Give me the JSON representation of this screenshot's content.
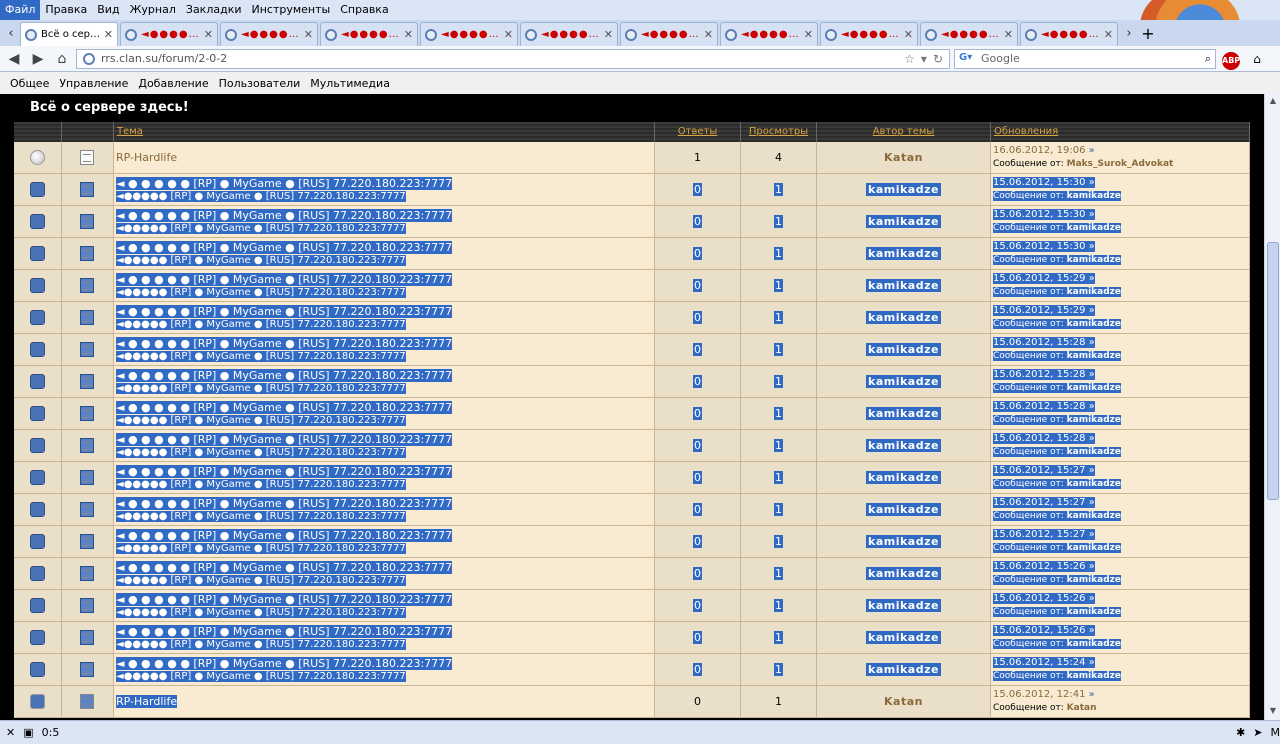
{
  "menubar": [
    "Файл",
    "Правка",
    "Вид",
    "Журнал",
    "Закладки",
    "Инструменты",
    "Справка"
  ],
  "tabs": {
    "active_title": "Всё о сер…",
    "other_title": "◄●●●●…"
  },
  "navbar": {
    "url": "rrs.clan.su/forum/2-0-2",
    "search_placeholder": "Google"
  },
  "bookmarks": [
    "Общее",
    "Управление",
    "Добавление",
    "Пользователи",
    "Мультимедиа"
  ],
  "forum": {
    "title": "Всё о сервере здесь!",
    "headers": {
      "topic": "Тема",
      "replies": "Ответы",
      "views": "Просмотры",
      "author": "Автор темы",
      "updates": "Обновления"
    },
    "msg_from": "Сообщение от:",
    "rows": [
      {
        "title": "RP-Hardlife",
        "subtitle": "",
        "replies": "1",
        "views": "4",
        "author": "Katan",
        "date": "16.06.2012, 19:06",
        "last": "Maks_Surok_Advokat",
        "hl": false,
        "icon": "new"
      },
      {
        "title": "◄ ● ● ● ● ● [RP] ● MyGame ● [RUS] 77.220.180.223:7777",
        "subtitle": "◄●●●●● [RP] ● MyGame ● [RUS] 77.220.180.223:7777",
        "replies": "0",
        "views": "1",
        "author": "kamikadze",
        "date": "15.06.2012, 15:30",
        "last": "kamikadze",
        "hl": true,
        "icon": "new"
      },
      {
        "title": "◄ ● ● ● ● ● [RP] ● MyGame ● [RUS] 77.220.180.223:7777",
        "subtitle": "◄●●●●● [RP] ● MyGame ● [RUS] 77.220.180.223:7777",
        "replies": "0",
        "views": "1",
        "author": "kamikadze",
        "date": "15.06.2012, 15:30",
        "last": "kamikadze",
        "hl": true,
        "icon": "old"
      },
      {
        "title": "◄ ● ● ● ● ● [RP] ● MyGame ● [RUS] 77.220.180.223:7777",
        "subtitle": "◄●●●●● [RP] ● MyGame ● [RUS] 77.220.180.223:7777",
        "replies": "0",
        "views": "1",
        "author": "kamikadze",
        "date": "15.06.2012, 15:30",
        "last": "kamikadze",
        "hl": true,
        "icon": "old"
      },
      {
        "title": "◄ ● ● ● ● ● [RP] ● MyGame ● [RUS] 77.220.180.223:7777",
        "subtitle": "◄●●●●● [RP] ● MyGame ● [RUS] 77.220.180.223:7777",
        "replies": "0",
        "views": "1",
        "author": "kamikadze",
        "date": "15.06.2012, 15:29",
        "last": "kamikadze",
        "hl": true,
        "icon": "old"
      },
      {
        "title": "◄ ● ● ● ● ● [RP] ● MyGame ● [RUS] 77.220.180.223:7777",
        "subtitle": "◄●●●●● [RP] ● MyGame ● [RUS] 77.220.180.223:7777",
        "replies": "0",
        "views": "1",
        "author": "kamikadze",
        "date": "15.06.2012, 15:29",
        "last": "kamikadze",
        "hl": true,
        "icon": "old"
      },
      {
        "title": "◄ ● ● ● ● ● [RP] ● MyGame ● [RUS] 77.220.180.223:7777",
        "subtitle": "◄●●●●● [RP] ● MyGame ● [RUS] 77.220.180.223:7777",
        "replies": "0",
        "views": "1",
        "author": "kamikadze",
        "date": "15.06.2012, 15:28",
        "last": "kamikadze",
        "hl": true,
        "icon": "old"
      },
      {
        "title": "◄ ● ● ● ● ● [RP] ● MyGame ● [RUS] 77.220.180.223:7777",
        "subtitle": "◄●●●●● [RP] ● MyGame ● [RUS] 77.220.180.223:7777",
        "replies": "0",
        "views": "1",
        "author": "kamikadze",
        "date": "15.06.2012, 15:28",
        "last": "kamikadze",
        "hl": true,
        "icon": "old"
      },
      {
        "title": "◄ ● ● ● ● ● [RP] ● MyGame ● [RUS] 77.220.180.223:7777",
        "subtitle": "◄●●●●● [RP] ● MyGame ● [RUS] 77.220.180.223:7777",
        "replies": "0",
        "views": "1",
        "author": "kamikadze",
        "date": "15.06.2012, 15:28",
        "last": "kamikadze",
        "hl": true,
        "icon": "old"
      },
      {
        "title": "◄ ● ● ● ● ● [RP] ● MyGame ● [RUS] 77.220.180.223:7777",
        "subtitle": "◄●●●●● [RP] ● MyGame ● [RUS] 77.220.180.223:7777",
        "replies": "0",
        "views": "1",
        "author": "kamikadze",
        "date": "15.06.2012, 15:28",
        "last": "kamikadze",
        "hl": true,
        "icon": "old"
      },
      {
        "title": "◄ ● ● ● ● ● [RP] ● MyGame ● [RUS] 77.220.180.223:7777",
        "subtitle": "◄●●●●● [RP] ● MyGame ● [RUS] 77.220.180.223:7777",
        "replies": "0",
        "views": "1",
        "author": "kamikadze",
        "date": "15.06.2012, 15:27",
        "last": "kamikadze",
        "hl": true,
        "icon": "old"
      },
      {
        "title": "◄ ● ● ● ● ● [RP] ● MyGame ● [RUS] 77.220.180.223:7777",
        "subtitle": "◄●●●●● [RP] ● MyGame ● [RUS] 77.220.180.223:7777",
        "replies": "0",
        "views": "1",
        "author": "kamikadze",
        "date": "15.06.2012, 15:27",
        "last": "kamikadze",
        "hl": true,
        "icon": "old"
      },
      {
        "title": "◄ ● ● ● ● ● [RP] ● MyGame ● [RUS] 77.220.180.223:7777",
        "subtitle": "◄●●●●● [RP] ● MyGame ● [RUS] 77.220.180.223:7777",
        "replies": "0",
        "views": "1",
        "author": "kamikadze",
        "date": "15.06.2012, 15:27",
        "last": "kamikadze",
        "hl": true,
        "icon": "old"
      },
      {
        "title": "◄ ● ● ● ● ● [RP] ● MyGame ● [RUS] 77.220.180.223:7777",
        "subtitle": "◄●●●●● [RP] ● MyGame ● [RUS] 77.220.180.223:7777",
        "replies": "0",
        "views": "1",
        "author": "kamikadze",
        "date": "15.06.2012, 15:26",
        "last": "kamikadze",
        "hl": true,
        "icon": "old"
      },
      {
        "title": "◄ ● ● ● ● ● [RP] ● MyGame ● [RUS] 77.220.180.223:7777",
        "subtitle": "◄●●●●● [RP] ● MyGame ● [RUS] 77.220.180.223:7777",
        "replies": "0",
        "views": "1",
        "author": "kamikadze",
        "date": "15.06.2012, 15:26",
        "last": "kamikadze",
        "hl": true,
        "icon": "old"
      },
      {
        "title": "◄ ● ● ● ● ● [RP] ● MyGame ● [RUS] 77.220.180.223:7777",
        "subtitle": "◄●●●●● [RP] ● MyGame ● [RUS] 77.220.180.223:7777",
        "replies": "0",
        "views": "1",
        "author": "kamikadze",
        "date": "15.06.2012, 15:26",
        "last": "kamikadze",
        "hl": true,
        "icon": "old"
      },
      {
        "title": "◄ ● ● ● ● ● [RP] ● MyGame ● [RUS] 77.220.180.223:7777",
        "subtitle": "◄●●●●● [RP] ● MyGame ● [RUS] 77.220.180.223:7777",
        "replies": "0",
        "views": "1",
        "author": "kamikadze",
        "date": "15.06.2012, 15:24",
        "last": "kamikadze",
        "hl": true,
        "icon": "old"
      },
      {
        "title": "RP-Hardlife",
        "subtitle": "",
        "replies": "0",
        "views": "1",
        "author": "Katan",
        "date": "15.06.2012, 12:41",
        "last": "Katan",
        "hl": "partial",
        "icon": "old"
      }
    ]
  },
  "status": {
    "text": "0:5"
  },
  "colors": {
    "selection": "#316ac5",
    "header_link": "#d9a441",
    "row_bg": "#f8ebd2"
  }
}
